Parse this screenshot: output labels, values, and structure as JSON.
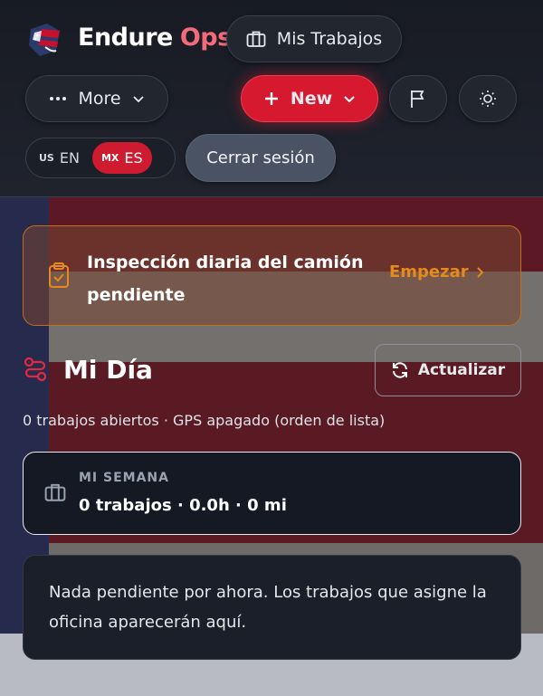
{
  "header": {
    "brand_word1": "Endure",
    "brand_word2": "Ops",
    "jobs_button": "Mis Trabajos",
    "more_button": "More",
    "new_button": "New",
    "logout_button": "Cerrar sesión",
    "languages": [
      {
        "code": "US",
        "label": "EN",
        "active": false
      },
      {
        "code": "MX",
        "label": "ES",
        "active": true
      }
    ]
  },
  "inspection": {
    "text": "Inspección diaria del camión pendiente",
    "action": "Empezar"
  },
  "day": {
    "title": "Mi Día",
    "refresh_button": "Actualizar",
    "subtitle": "0 trabajos abiertos · GPS apagado (orden de lista)"
  },
  "week": {
    "label": "MI SEMANA",
    "summary": "0 trabajos · 0.0h · 0 mi"
  },
  "empty_state": {
    "text": "Nada pendiente por ahora. Los trabajos que asigne la oficina aparecerán aquí."
  },
  "colors": {
    "brand_red": "#d7192f",
    "brand_pink": "#f26b7a",
    "warning_orange": "#e48a1e",
    "header_bg": "#1c1f28"
  },
  "icons": [
    "logo-flag-icon",
    "briefcase-icon",
    "dots-icon",
    "chevron-down-icon",
    "plus-icon",
    "flag-icon",
    "sun-icon",
    "clipboard-check-icon",
    "chevron-right-icon",
    "route-icon",
    "refresh-icon"
  ]
}
